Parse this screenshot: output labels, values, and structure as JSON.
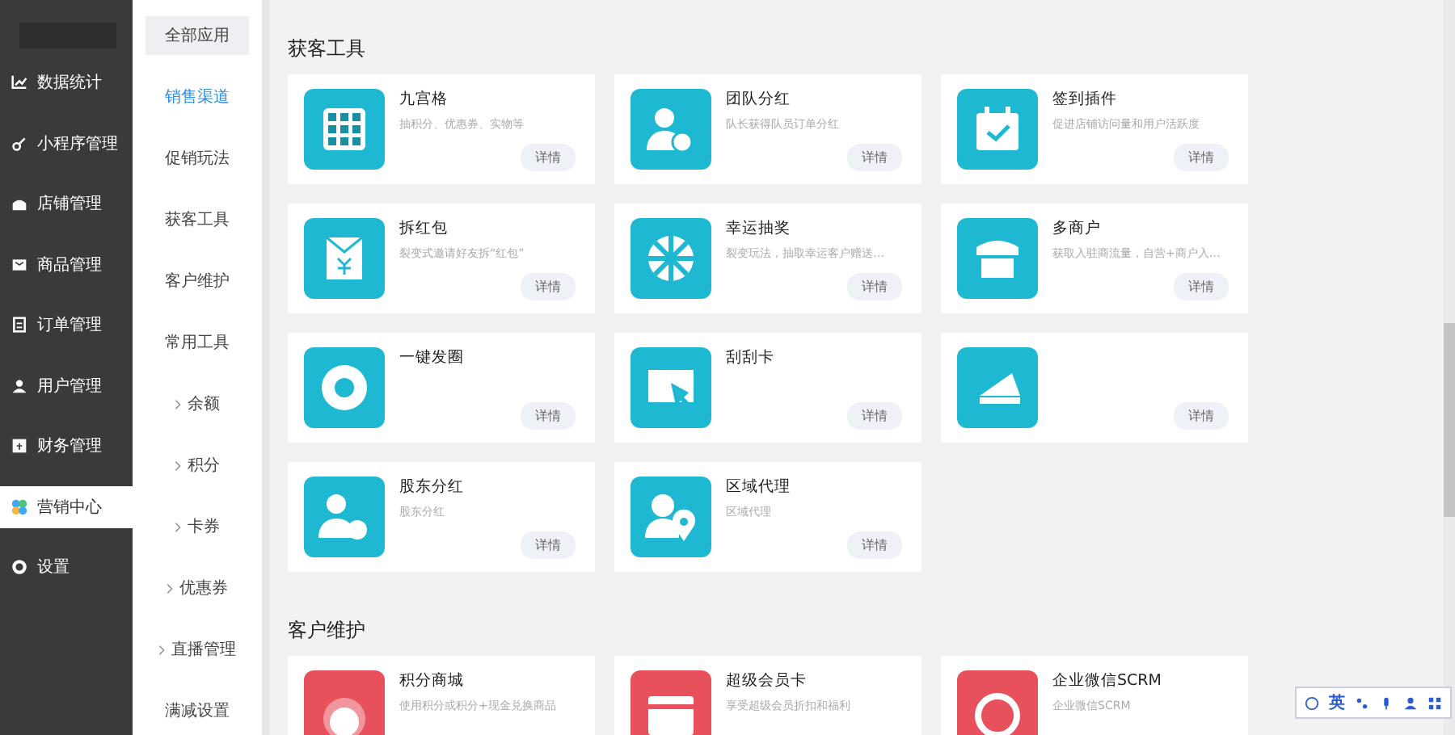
{
  "sidebar": {
    "items": [
      {
        "label": "数据统计",
        "kind": "chart",
        "selected": false
      },
      {
        "label": "小程序管理",
        "kind": "link",
        "selected": false
      },
      {
        "label": "店铺管理",
        "kind": "shop",
        "selected": false
      },
      {
        "label": "商品管理",
        "kind": "box",
        "selected": false
      },
      {
        "label": "订单管理",
        "kind": "order",
        "selected": false
      },
      {
        "label": "用户管理",
        "kind": "user",
        "selected": false
      },
      {
        "label": "财务管理",
        "kind": "finance",
        "selected": false
      },
      {
        "label": "营销中心",
        "kind": "marketing",
        "selected": true
      },
      {
        "label": "设置",
        "kind": "settings",
        "selected": false
      }
    ]
  },
  "subnav": {
    "items": [
      {
        "label": "全部应用",
        "expandable": false,
        "selected": true,
        "highlighted": false
      },
      {
        "label": "销售渠道",
        "expandable": false,
        "selected": false,
        "highlighted": true
      },
      {
        "label": "促销玩法",
        "expandable": false,
        "selected": false,
        "highlighted": false
      },
      {
        "label": "获客工具",
        "expandable": false,
        "selected": false,
        "highlighted": false
      },
      {
        "label": "客户维护",
        "expandable": false,
        "selected": false,
        "highlighted": false
      },
      {
        "label": "常用工具",
        "expandable": false,
        "selected": false,
        "highlighted": false
      },
      {
        "label": "余额",
        "expandable": true,
        "selected": false,
        "highlighted": false
      },
      {
        "label": "积分",
        "expandable": true,
        "selected": false,
        "highlighted": false
      },
      {
        "label": "卡券",
        "expandable": true,
        "selected": false,
        "highlighted": false
      },
      {
        "label": "优惠券",
        "expandable": true,
        "selected": false,
        "highlighted": false
      },
      {
        "label": "直播管理",
        "expandable": true,
        "selected": false,
        "highlighted": false
      },
      {
        "label": "满减设置",
        "expandable": false,
        "selected": false,
        "highlighted": false
      }
    ]
  },
  "sections": [
    {
      "title": "获客工具",
      "cards": [
        {
          "title": "九宫格",
          "description": "抽积分、优惠券、实物等",
          "button": "详情",
          "kind": "grid",
          "color": "#1fb8d3"
        },
        {
          "title": "团队分红",
          "description": "队长获得队员订单分红",
          "button": "详情",
          "kind": "team",
          "color": "#1fb8d3"
        },
        {
          "title": "签到插件",
          "description": "促进店铺访问量和用户活跃度",
          "button": "详情",
          "kind": "calendar",
          "color": "#1fb8d3"
        },
        {
          "title": "拆红包",
          "description": "裂变式邀请好友拆“红包”",
          "button": "详情",
          "kind": "envelope",
          "color": "#1fb8d3"
        },
        {
          "title": "幸运抽奖",
          "description": "裂变玩法，抽取幸运客户赠送…",
          "button": "详情",
          "kind": "wheel",
          "color": "#1fb8d3"
        },
        {
          "title": "多商户",
          "description": "获取入驻商流量，自营+商户入…",
          "button": "详情",
          "kind": "store",
          "color": "#1fb8d3"
        },
        {
          "title": "一键发圈",
          "button": "详情",
          "kind": "aperture",
          "color": "#1fb8d3"
        },
        {
          "title": "刮刮卡",
          "button": "详情",
          "kind": "screen",
          "color": "#1fb8d3"
        },
        {
          "button": "详情",
          "kind": "slice",
          "color": "#1fb8d3"
        },
        {
          "title": "股东分红",
          "description": "股东分红",
          "button": "详情",
          "kind": "shareholder",
          "color": "#1fb8d3"
        },
        {
          "title": "区域代理",
          "description": "区域代理",
          "button": "详情",
          "kind": "region",
          "color": "#1fb8d3"
        }
      ]
    },
    {
      "title": "客户维护",
      "cards": [
        {
          "title": "积分商城",
          "description": "使用积分或积分+现金兑换商品",
          "kind": "points",
          "color": "#e8505b"
        },
        {
          "title": "超级会员卡",
          "description": "享受超级会员折扣和福利",
          "kind": "card",
          "color": "#e8505b"
        },
        {
          "title": "企业微信SCRM",
          "description": "企业微信SCRM",
          "kind": "chat",
          "color": "#e8505b"
        }
      ]
    }
  ],
  "ime_toolbar": {
    "label": "英"
  }
}
